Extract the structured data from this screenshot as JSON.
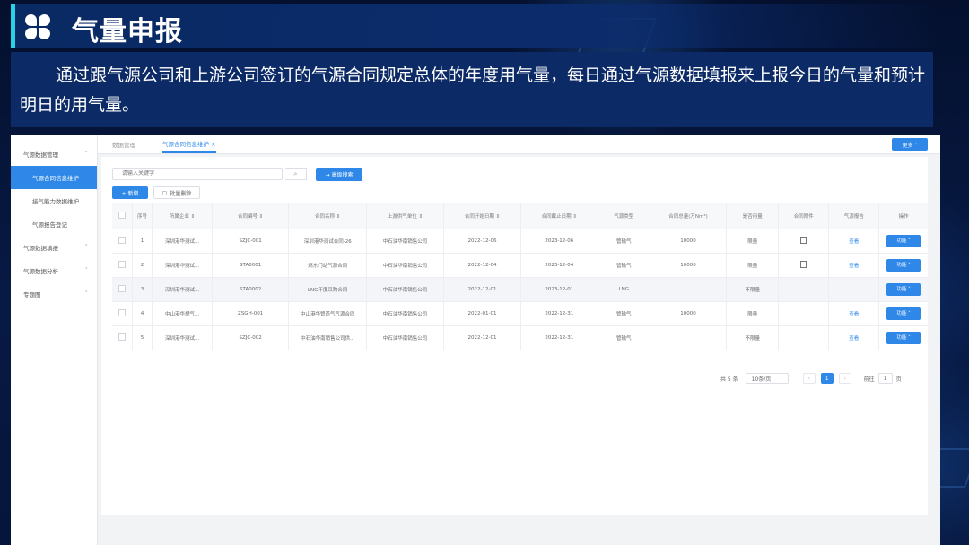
{
  "header": {
    "title": "气量申报",
    "description": "通过跟气源公司和上游公司签订的气源合同规定总体的年度用气量，每日通过气源数据填报来上报今日的气量和预计明日的用气量。"
  },
  "screen": {
    "sidebar": [
      {
        "label": "气源数据管理",
        "chevron": "˄"
      },
      {
        "label": "气源合同信息维护",
        "active": true
      },
      {
        "label": "接气能力数据维护"
      },
      {
        "label": "气源报告登记"
      },
      {
        "label": "气源数据填报",
        "chevron": "˅"
      },
      {
        "label": "气源数据分析",
        "chevron": "˅"
      },
      {
        "label": "专题图",
        "chevron": "˅"
      }
    ],
    "tabs": [
      {
        "label": "数据管理"
      },
      {
        "label": "气源合同信息维护 ×"
      }
    ],
    "more_button": "更多 ˅",
    "search": {
      "placeholder": "请输入关键字",
      "icon": "search-icon"
    },
    "advanced_search_button": "→ 高级搜索",
    "new_button": "+ 新增",
    "batch_delete_button": "批量删除",
    "columns": [
      "序号",
      "所属企业 ⇕",
      "合同编号 ⇕",
      "合同名称 ⇕",
      "上游供气单位 ⇕",
      "合同开始日期 ⇕",
      "合同截止日期 ⇕",
      "气源类型",
      "合同总量(万Nm³)",
      "是否用量",
      "合同附件",
      "气源报告",
      "操作"
    ],
    "rows": [
      {
        "no": "1",
        "company": "深圳港华测试...",
        "code": "SZJC-001",
        "name": "深圳港华测试合同-26",
        "supplier": "中石油华南销售公司",
        "start": "2022-12-06",
        "end": "2023-12-06",
        "type": "管输气",
        "total": "10000",
        "used": "限量",
        "file": true,
        "report": "查看",
        "action": "功能 ˅"
      },
      {
        "no": "2",
        "company": "深圳港华测试...",
        "code": "STA0001",
        "name": "燃东门站气源合同",
        "supplier": "中石油华南销售公司",
        "start": "2022-12-04",
        "end": "2023-12-04",
        "type": "管输气",
        "total": "10000",
        "used": "限量",
        "file": true,
        "report": "查看",
        "action": "功能 ˅"
      },
      {
        "no": "3",
        "company": "深圳港华测试...",
        "code": "STA0002",
        "name": "LNG年度采购合同",
        "supplier": "中石油华南销售公司",
        "start": "2022-12-01",
        "end": "2023-12-01",
        "type": "LNG",
        "total": "",
        "used": "不限量",
        "file": false,
        "report": "",
        "action": "功能 ˅"
      },
      {
        "no": "4",
        "company": "中山港华燃气...",
        "code": "ZSGH-001",
        "name": "中山港华管道气气源合同",
        "supplier": "中石油华南销售公司",
        "start": "2022-01-01",
        "end": "2022-12-31",
        "type": "管输气",
        "total": "10000",
        "used": "限量",
        "file": false,
        "report": "查看",
        "action": "功能 ˅"
      },
      {
        "no": "5",
        "company": "深圳港华测试...",
        "code": "SZJC-002",
        "name": "中石油华南销售公司供...",
        "supplier": "中石油华南销售公司",
        "start": "2022-12-01",
        "end": "2022-12-31",
        "type": "管输气",
        "total": "",
        "used": "不限量",
        "file": false,
        "report": "查看",
        "action": "功能 ˅"
      }
    ],
    "pager": {
      "total": "共 5 条",
      "page_size": "10条/页",
      "prev": "‹",
      "current": "1",
      "next": "›",
      "goto_label": "前往",
      "goto_value": "1",
      "page_unit": "页"
    }
  }
}
